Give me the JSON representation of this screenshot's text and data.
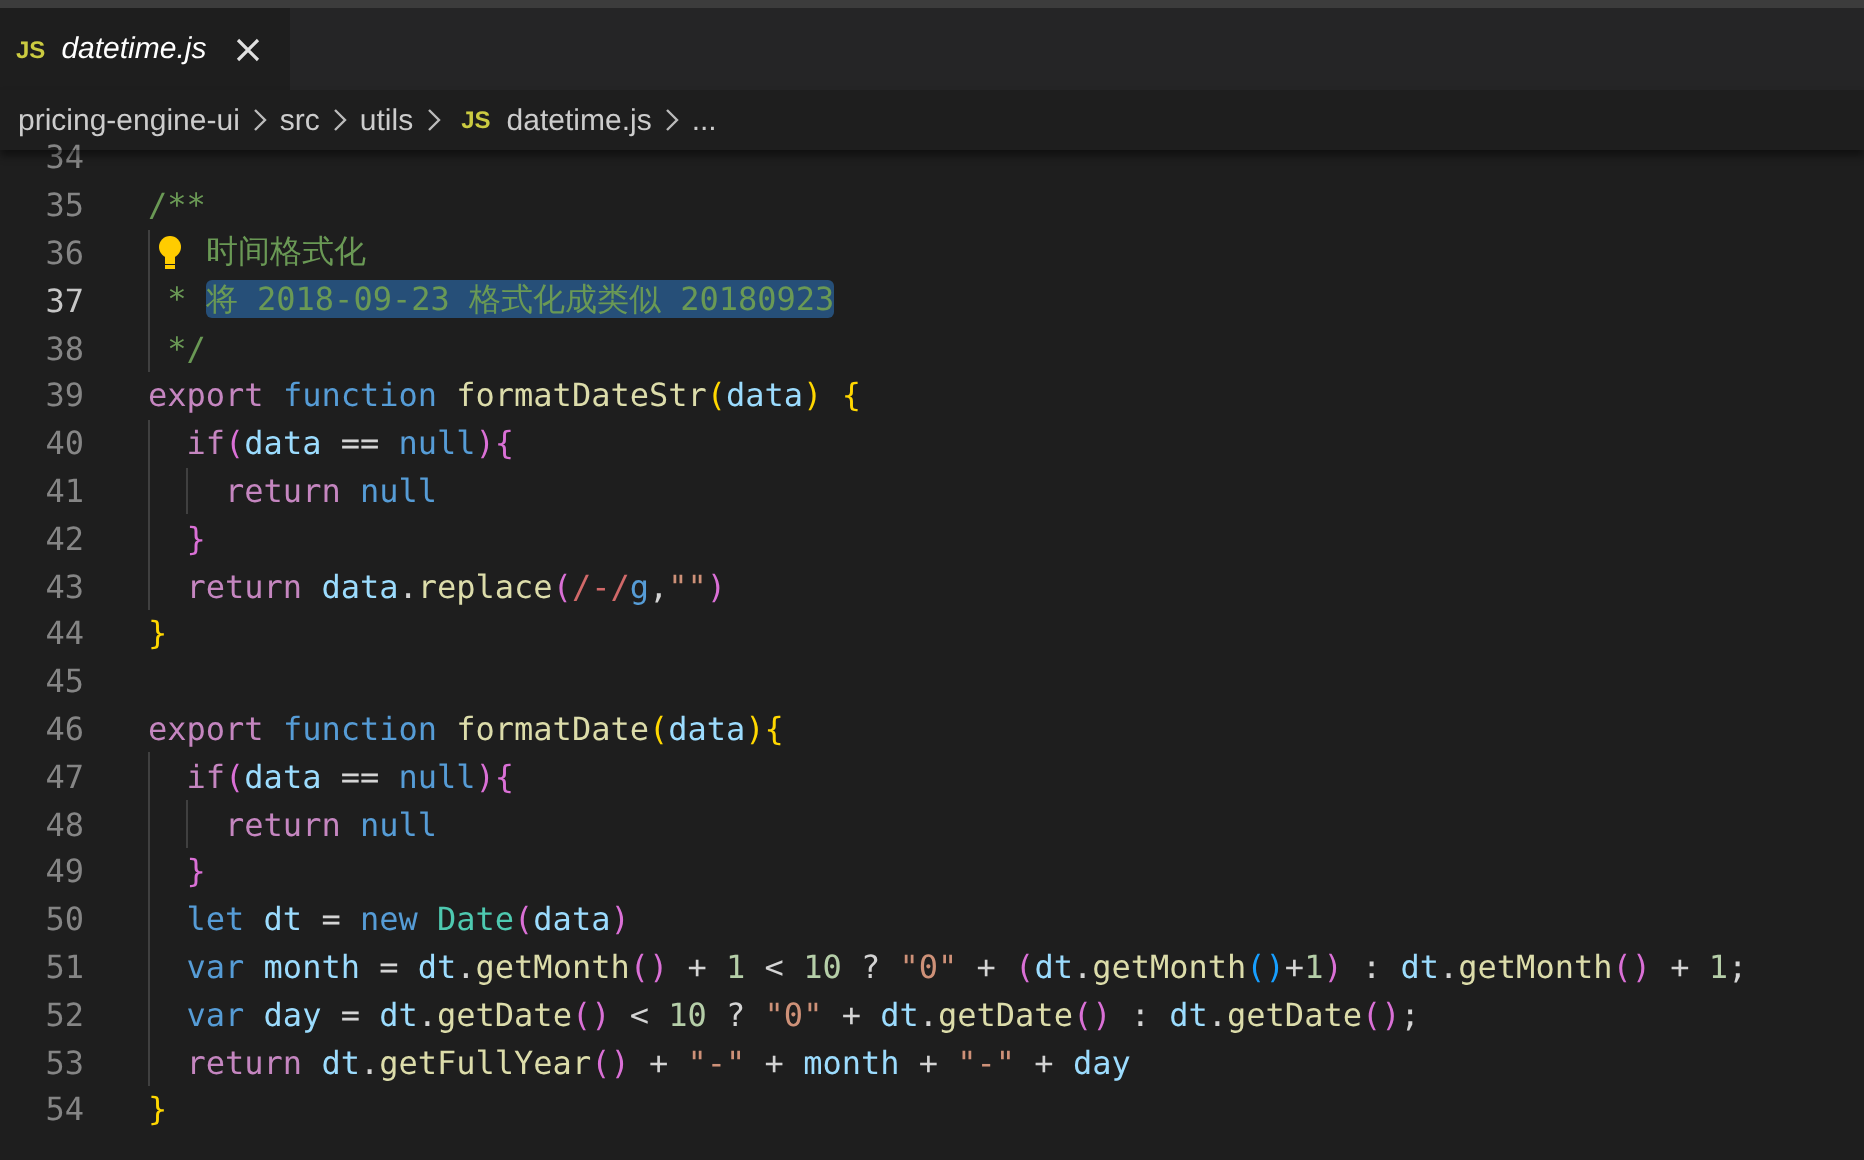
{
  "tabs": [
    {
      "badge": "JS",
      "label": "datetime.js",
      "preview": true,
      "selected": true
    }
  ],
  "breadcrumb": [
    {
      "label": "pricing-engine-ui"
    },
    {
      "label": "src"
    },
    {
      "label": "utils"
    },
    {
      "badge": "JS",
      "label": "datetime.js"
    },
    {
      "label": "..."
    }
  ],
  "editor": {
    "lines": [
      {
        "number": "34",
        "current": false
      },
      {
        "number": "35",
        "current": false,
        "tokens": [
          {
            "text": "/**",
            "kind": "comment"
          }
        ]
      },
      {
        "number": "36",
        "current": false,
        "lightbulb": true,
        "tokens": [
          {
            "text": "时间格式化",
            "kind": "comment"
          }
        ]
      },
      {
        "number": "37",
        "current": true,
        "tokens": [
          {
            "text": " * ",
            "kind": "comment"
          },
          {
            "text": "将 2018-09-23 格式化成类似 20180923",
            "kind": "comment",
            "selected": true
          }
        ]
      },
      {
        "number": "38",
        "current": false,
        "tokens": [
          {
            "text": " */",
            "kind": "comment"
          }
        ]
      },
      {
        "number": "39",
        "current": false,
        "tokens": [
          {
            "text": "export ",
            "kind": "control"
          },
          {
            "text": "function ",
            "kind": "storage"
          },
          {
            "text": "formatDateStr",
            "kind": "function"
          },
          {
            "text": "(",
            "kind": "bracket1"
          },
          {
            "text": "data",
            "kind": "variable"
          },
          {
            "text": ") {",
            "kind": "bracket1"
          }
        ]
      },
      {
        "number": "40",
        "current": false,
        "tokens": [
          {
            "text": "  if",
            "kind": "control"
          },
          {
            "text": "(",
            "kind": "bracket2"
          },
          {
            "text": "data",
            "kind": "variable"
          },
          {
            "text": " == ",
            "kind": "plain"
          },
          {
            "text": "null",
            "kind": "storage"
          },
          {
            "text": "){",
            "kind": "bracket2"
          }
        ]
      },
      {
        "number": "41",
        "current": false,
        "tokens": [
          {
            "text": "    return ",
            "kind": "control"
          },
          {
            "text": "null",
            "kind": "storage"
          }
        ]
      },
      {
        "number": "42",
        "current": false,
        "tokens": [
          {
            "text": "  }",
            "kind": "bracket2"
          }
        ]
      },
      {
        "number": "43",
        "current": false,
        "tokens": [
          {
            "text": "  return ",
            "kind": "control"
          },
          {
            "text": "data",
            "kind": "variable"
          },
          {
            "text": ".",
            "kind": "plain"
          },
          {
            "text": "replace",
            "kind": "function"
          },
          {
            "text": "(",
            "kind": "bracket2"
          },
          {
            "text": "/-/",
            "kind": "regex"
          },
          {
            "text": "g",
            "kind": "storage"
          },
          {
            "text": ",",
            "kind": "plain"
          },
          {
            "text": "\"\"",
            "kind": "string"
          },
          {
            "text": ")",
            "kind": "bracket2"
          }
        ]
      },
      {
        "number": "44",
        "current": false,
        "tokens": [
          {
            "text": "}",
            "kind": "bracket1"
          }
        ]
      },
      {
        "number": "45",
        "current": false
      },
      {
        "number": "46",
        "current": false,
        "tokens": [
          {
            "text": "export ",
            "kind": "control"
          },
          {
            "text": "function ",
            "kind": "storage"
          },
          {
            "text": "formatDate",
            "kind": "function"
          },
          {
            "text": "(",
            "kind": "bracket1"
          },
          {
            "text": "data",
            "kind": "variable"
          },
          {
            "text": "){",
            "kind": "bracket1"
          }
        ]
      },
      {
        "number": "47",
        "current": false,
        "tokens": [
          {
            "text": "  if",
            "kind": "control"
          },
          {
            "text": "(",
            "kind": "bracket2"
          },
          {
            "text": "data",
            "kind": "variable"
          },
          {
            "text": " == ",
            "kind": "plain"
          },
          {
            "text": "null",
            "kind": "storage"
          },
          {
            "text": "){",
            "kind": "bracket2"
          }
        ]
      },
      {
        "number": "48",
        "current": false,
        "tokens": [
          {
            "text": "    return ",
            "kind": "control"
          },
          {
            "text": "null",
            "kind": "storage"
          }
        ]
      },
      {
        "number": "49",
        "current": false,
        "tokens": [
          {
            "text": "  }",
            "kind": "bracket2"
          }
        ]
      },
      {
        "number": "50",
        "current": false,
        "tokens": [
          {
            "text": "  let ",
            "kind": "storage"
          },
          {
            "text": "dt",
            "kind": "variable"
          },
          {
            "text": " = ",
            "kind": "plain"
          },
          {
            "text": "new ",
            "kind": "storage"
          },
          {
            "text": "Date",
            "kind": "class"
          },
          {
            "text": "(",
            "kind": "bracket2"
          },
          {
            "text": "data",
            "kind": "variable"
          },
          {
            "text": ")",
            "kind": "bracket2"
          }
        ]
      },
      {
        "number": "51",
        "current": false,
        "tokens": [
          {
            "text": "  var ",
            "kind": "storage"
          },
          {
            "text": "month",
            "kind": "variable"
          },
          {
            "text": " = ",
            "kind": "plain"
          },
          {
            "text": "dt",
            "kind": "variable"
          },
          {
            "text": ".",
            "kind": "plain"
          },
          {
            "text": "getMonth",
            "kind": "function"
          },
          {
            "text": "()",
            "kind": "bracket2"
          },
          {
            "text": " + ",
            "kind": "plain"
          },
          {
            "text": "1",
            "kind": "number"
          },
          {
            "text": " < ",
            "kind": "plain"
          },
          {
            "text": "10",
            "kind": "number"
          },
          {
            "text": " ? ",
            "kind": "plain"
          },
          {
            "text": "\"0\"",
            "kind": "string"
          },
          {
            "text": " + ",
            "kind": "plain"
          },
          {
            "text": "(",
            "kind": "bracket2"
          },
          {
            "text": "dt",
            "kind": "variable"
          },
          {
            "text": ".",
            "kind": "plain"
          },
          {
            "text": "getMonth",
            "kind": "function"
          },
          {
            "text": "()",
            "kind": "bracket3"
          },
          {
            "text": "+",
            "kind": "plain"
          },
          {
            "text": "1",
            "kind": "number"
          },
          {
            "text": ")",
            "kind": "bracket2"
          },
          {
            "text": " : ",
            "kind": "plain"
          },
          {
            "text": "dt",
            "kind": "variable"
          },
          {
            "text": ".",
            "kind": "plain"
          },
          {
            "text": "getMonth",
            "kind": "function"
          },
          {
            "text": "()",
            "kind": "bracket2"
          },
          {
            "text": " + ",
            "kind": "plain"
          },
          {
            "text": "1",
            "kind": "number"
          },
          {
            "text": ";",
            "kind": "plain"
          }
        ]
      },
      {
        "number": "52",
        "current": false,
        "tokens": [
          {
            "text": "  var ",
            "kind": "storage"
          },
          {
            "text": "day",
            "kind": "variable"
          },
          {
            "text": " = ",
            "kind": "plain"
          },
          {
            "text": "dt",
            "kind": "variable"
          },
          {
            "text": ".",
            "kind": "plain"
          },
          {
            "text": "getDate",
            "kind": "function"
          },
          {
            "text": "()",
            "kind": "bracket2"
          },
          {
            "text": " < ",
            "kind": "plain"
          },
          {
            "text": "10",
            "kind": "number"
          },
          {
            "text": " ? ",
            "kind": "plain"
          },
          {
            "text": "\"0\"",
            "kind": "string"
          },
          {
            "text": " + ",
            "kind": "plain"
          },
          {
            "text": "dt",
            "kind": "variable"
          },
          {
            "text": ".",
            "kind": "plain"
          },
          {
            "text": "getDate",
            "kind": "function"
          },
          {
            "text": "()",
            "kind": "bracket2"
          },
          {
            "text": " : ",
            "kind": "plain"
          },
          {
            "text": "dt",
            "kind": "variable"
          },
          {
            "text": ".",
            "kind": "plain"
          },
          {
            "text": "getDate",
            "kind": "function"
          },
          {
            "text": "()",
            "kind": "bracket2"
          },
          {
            "text": ";",
            "kind": "plain"
          }
        ]
      },
      {
        "number": "53",
        "current": false,
        "tokens": [
          {
            "text": "  return ",
            "kind": "control"
          },
          {
            "text": "dt",
            "kind": "variable"
          },
          {
            "text": ".",
            "kind": "plain"
          },
          {
            "text": "getFullYear",
            "kind": "function"
          },
          {
            "text": "()",
            "kind": "bracket2"
          },
          {
            "text": " + ",
            "kind": "plain"
          },
          {
            "text": "\"-\"",
            "kind": "string"
          },
          {
            "text": " + ",
            "kind": "plain"
          },
          {
            "text": "month",
            "kind": "variable"
          },
          {
            "text": " + ",
            "kind": "plain"
          },
          {
            "text": "\"-\"",
            "kind": "string"
          },
          {
            "text": " + ",
            "kind": "plain"
          },
          {
            "text": "day",
            "kind": "variable"
          }
        ]
      },
      {
        "number": "54",
        "current": false,
        "tokens": [
          {
            "text": "}",
            "kind": "bracket1"
          }
        ]
      }
    ]
  }
}
